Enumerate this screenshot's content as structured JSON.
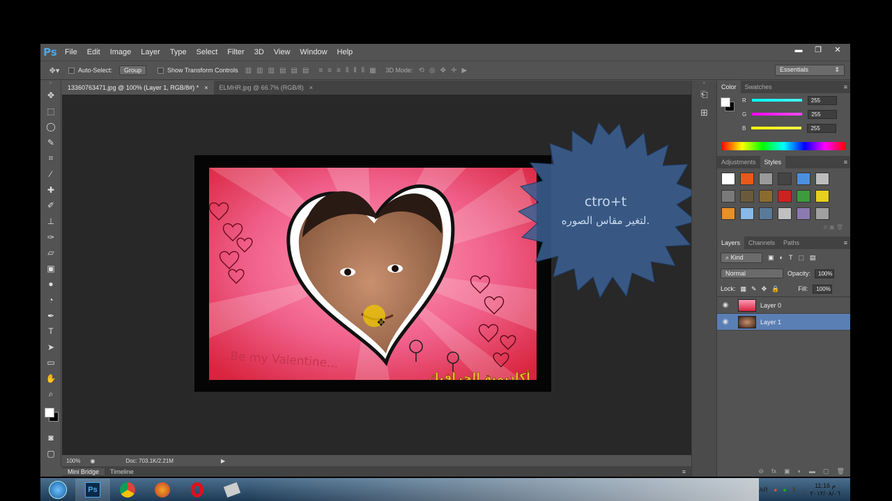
{
  "menu": {
    "logo": "Ps",
    "items": [
      "File",
      "Edit",
      "Image",
      "Layer",
      "Type",
      "Select",
      "Filter",
      "3D",
      "View",
      "Window",
      "Help"
    ]
  },
  "window_controls": {
    "minimize": "▬",
    "restore": "❐",
    "close": "✕"
  },
  "options": {
    "auto_select": "Auto-Select:",
    "group": "Group",
    "show_transform": "Show Transform Controls",
    "mode_3d": "3D Mode:",
    "workspace": "Essentials"
  },
  "doc_tabs": [
    {
      "label": "13360763471.jpg @ 100% (Layer 1, RGB/8#) *",
      "close": "×"
    },
    {
      "label": "ELMHR.jpg @ 66.7% (RGB/8)",
      "close": "×"
    }
  ],
  "artwork": {
    "caption": "...Be my Valentine...",
    "watermark": "أكاديمية الجرافيك"
  },
  "callout": {
    "shortcut": "ctro+t",
    "arabic_text": "لتغير مقاس الصوره."
  },
  "status": {
    "zoom": "100%",
    "doc": "Doc: 703.1K/2.21M"
  },
  "bottom_tabs": [
    "Mini Bridge",
    "Timeline"
  ],
  "color_panel": {
    "tabs": [
      "Color",
      "Swatches"
    ],
    "channels": [
      {
        "label": "R",
        "value": "255",
        "color": "#4df0f0"
      },
      {
        "label": "G",
        "value": "255",
        "color": "#f04df0"
      },
      {
        "label": "B",
        "value": "255",
        "color": "#f0f04d"
      }
    ]
  },
  "styles_panel": {
    "tabs": [
      "Adjustments",
      "Styles"
    ],
    "swatches": [
      "#ffffff",
      "#e85a1a",
      "#9a9a9a",
      "#444444",
      "#4a90e0",
      "#bdbdbd",
      "#7a7a7a",
      "#6b5a3a",
      "#8a6b30",
      "#d02020",
      "#3c9b3c",
      "#e6d020",
      "#e8902a",
      "#8ab8e8",
      "#5a7a9a",
      "#c0c0c0",
      "#8a7ab0",
      "#a0a0a0"
    ]
  },
  "layers_panel": {
    "tabs": [
      "Layers",
      "Channels",
      "Paths"
    ],
    "kind": "Kind",
    "blend_mode": "Normal",
    "opacity_label": "Opacity:",
    "opacity_value": "100%",
    "lock_label": "Lock:",
    "fill_label": "Fill:",
    "fill_value": "100%",
    "layers": [
      {
        "name": "Layer 0",
        "selected": false
      },
      {
        "name": "Layer 1",
        "selected": true
      }
    ]
  },
  "taskbar": {
    "apps": [
      "Windows",
      "Photoshop",
      "Chrome",
      "Firefox",
      "Opera",
      "Other"
    ],
    "lang": "AR",
    "time": "11:16 م",
    "date": "٢٠١٢/٠٨/٠٦"
  }
}
